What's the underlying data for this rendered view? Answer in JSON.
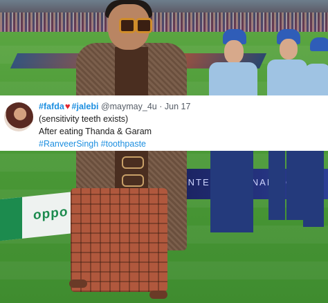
{
  "scene": {
    "banner_logo": "oppo",
    "board_text": "INTERNATIONAL MO",
    "colors": {
      "grass": "#4b9a37",
      "carpet_blue": "#2b3f8a",
      "carpet_red": "#d9412b"
    }
  },
  "tweet": {
    "hashtag1": "#fafda",
    "heart_icon": "♥",
    "hashtag2": "#jalebi",
    "handle": "@maymay_4u",
    "separator": "·",
    "date": "Jun 17",
    "line2": "(sensitivity teeth exists)",
    "line3": "After eating Thanda & Garam",
    "hashtag3": "#RanveerSingh",
    "hashtag4": "#toothpaste",
    "accent_color": "#1d8fe0",
    "heart_color": "#e0242e"
  }
}
